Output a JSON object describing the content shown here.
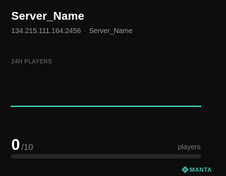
{
  "server": {
    "name": "Server_Name",
    "address": "134.215.111.164:2456",
    "separator": "·",
    "subtitle_name": "Server_Name"
  },
  "history": {
    "label": "24H PLAYERS"
  },
  "chart_data": {
    "type": "line",
    "title": "24H PLAYERS",
    "xlabel": "",
    "ylabel": "",
    "series": [
      {
        "values": [
          0,
          0,
          0,
          0,
          0,
          0,
          0,
          0,
          0,
          0,
          0,
          0,
          0,
          0,
          0,
          0,
          0,
          0,
          0,
          0,
          0,
          0,
          0,
          0
        ]
      }
    ],
    "ylim": [
      0,
      10
    ],
    "grid": false,
    "colors": {
      "line": "#3cc7b0"
    }
  },
  "players": {
    "current": "0",
    "max": "/10",
    "label": "players",
    "fill_fraction": 0
  },
  "branding": {
    "text": "MANTA",
    "icon": "diamond-logo-icon"
  },
  "colors": {
    "background": "#0d0d0d",
    "accent": "#3cc7b0"
  }
}
